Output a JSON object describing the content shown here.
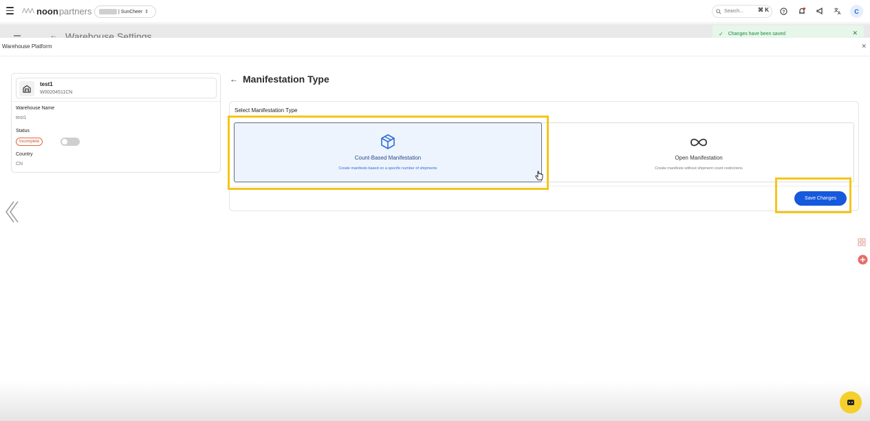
{
  "topbar": {
    "logo_brand": "noon",
    "logo_suffix": "partners",
    "store_name": "| SunCheer",
    "search_placeholder": "Search...",
    "search_shortcut": "⌘ K",
    "avatar_initial": "C"
  },
  "background_page": {
    "title": "Warehouse Settings"
  },
  "toast": {
    "message": "Changes have been saved"
  },
  "modal": {
    "title": "Warehouse Platform"
  },
  "warehouse": {
    "name": "test1",
    "code": "W00204511CN",
    "fields": {
      "name_label": "Warehouse Name",
      "name_value": "test1",
      "status_label": "Status",
      "status_badge": "Incomplete",
      "country_label": "Country",
      "country_value": "CN"
    }
  },
  "main": {
    "title": "Manifestation Type",
    "section_label": "Select Manifestation Type",
    "options": [
      {
        "title": "Count-Based Manifestation",
        "description": "Create manifests based on a specific number of shipments",
        "icon": "cube-icon",
        "selected": true
      },
      {
        "title": "Open Manifestation",
        "description": "Create manifests without shipment count restrictions",
        "icon": "infinity-icon",
        "selected": false
      }
    ],
    "save_label": "Save Changes"
  },
  "colors": {
    "accent": "#1659dd",
    "highlight": "#f5c518",
    "toast_bg": "#e6f6ea",
    "toast_text": "#1f8a3a",
    "selected_bg": "#edf4fd",
    "badge": "#d1542a"
  }
}
